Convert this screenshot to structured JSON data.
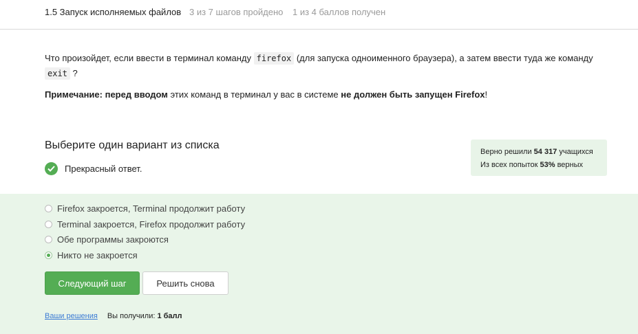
{
  "header": {
    "title": "1.5 Запуск исполняемых файлов",
    "steps": "3 из 7 шагов пройдено",
    "points": "1 из 4 баллов  получен"
  },
  "question": {
    "part1": "Что произойдет, если ввести в терминал команду ",
    "code1": "firefox",
    "part2": " (для запуска одноименного браузера), а затем ввести туда же команду ",
    "code2": "exit",
    "part3": " ?"
  },
  "note": {
    "bold1": "Примечание: перед вводом",
    "text1": " этих команд в терминал у вас в системе ",
    "bold2": "не должен быть запущен Firefox",
    "text2": "!"
  },
  "quiz": {
    "title": "Выберите один вариант из списка",
    "feedback": "Прекрасный ответ."
  },
  "stats": {
    "line1_prefix": "Верно решили ",
    "line1_value": "54 317",
    "line1_suffix": " учащихся",
    "line2_prefix": "Из всех попыток ",
    "line2_value": "53%",
    "line2_suffix": " верных"
  },
  "options": [
    {
      "label": "Firefox закроется, Terminal продолжит работу",
      "selected": false
    },
    {
      "label": "Terminal закроется, Firefox продолжит работу",
      "selected": false
    },
    {
      "label": "Обе программы закроются",
      "selected": false
    },
    {
      "label": "Никто не закроется",
      "selected": true
    }
  ],
  "buttons": {
    "next": "Следующий шаг",
    "retry": "Решить снова"
  },
  "footer": {
    "solutions_link": "Ваши решения",
    "received_prefix": "Вы получили: ",
    "received_value": "1 балл"
  },
  "colors": {
    "accent": "#54ad54",
    "answers_bg": "#e9f5e9",
    "stats_bg": "#e8f4e8",
    "link": "#3b7bd4"
  }
}
